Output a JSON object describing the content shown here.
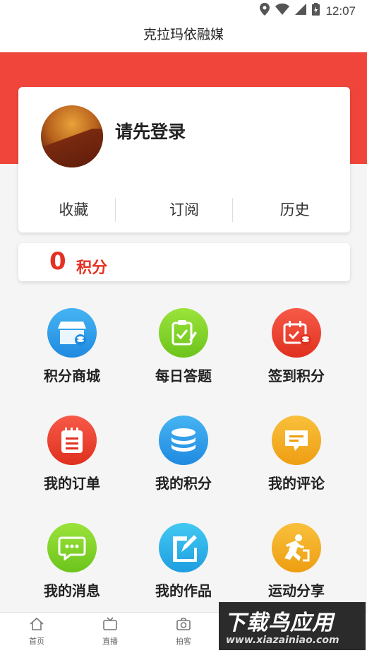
{
  "status_bar": {
    "time": "12:07",
    "icons": [
      "location-icon",
      "wifi-icon",
      "signal-icon",
      "battery-icon"
    ]
  },
  "header": {
    "title": "克拉玛依融媒"
  },
  "colors": {
    "accent": "#f0453a",
    "points": "#e53123"
  },
  "profile": {
    "login_prompt": "请先登录",
    "tabs": [
      {
        "label": "收藏"
      },
      {
        "label": "订阅"
      },
      {
        "label": "历史"
      }
    ]
  },
  "points": {
    "value": "0",
    "label": "积分"
  },
  "features": [
    {
      "label": "积分商城",
      "icon": "store-icon",
      "color": "#2a9be8"
    },
    {
      "label": "每日答题",
      "icon": "quiz-icon",
      "color": "#7ed321"
    },
    {
      "label": "签到积分",
      "icon": "checkin-icon",
      "color": "#f0453a"
    },
    {
      "label": "我的订单",
      "icon": "order-icon",
      "color": "#f0453a"
    },
    {
      "label": "我的积分",
      "icon": "coins-icon",
      "color": "#2a9be8"
    },
    {
      "label": "我的评论",
      "icon": "comment-icon",
      "color": "#f3b022"
    },
    {
      "label": "我的消息",
      "icon": "message-icon",
      "color": "#7ed321"
    },
    {
      "label": "我的作品",
      "icon": "works-icon",
      "color": "#2ab0e8"
    },
    {
      "label": "运动分享",
      "icon": "sport-icon",
      "color": "#f3b022"
    }
  ],
  "bottom_nav": [
    {
      "label": "首页",
      "icon": "home-icon"
    },
    {
      "label": "直播",
      "icon": "tv-icon"
    },
    {
      "label": "拍客",
      "icon": "camera-icon"
    }
  ],
  "watermark": {
    "title": "下载鸟应用",
    "url": "www.xiazainiao.com"
  }
}
